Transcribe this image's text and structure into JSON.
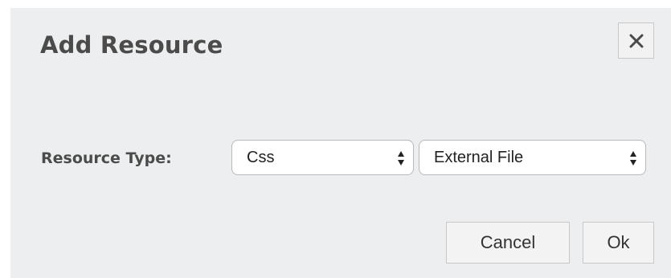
{
  "dialog": {
    "title": "Add Resource",
    "close_icon": "close-icon"
  },
  "resource_type": {
    "label": "Resource Type:",
    "type_select": {
      "selected": "Css",
      "icon": "select-arrows-icon"
    },
    "source_select": {
      "selected": "External File",
      "icon": "select-arrows-icon"
    }
  },
  "footer": {
    "cancel_label": "Cancel",
    "ok_label": "Ok"
  },
  "colors": {
    "dialog_background": "#eceeef",
    "title_text": "#4b4b4b",
    "border": "#c8c8c8"
  }
}
